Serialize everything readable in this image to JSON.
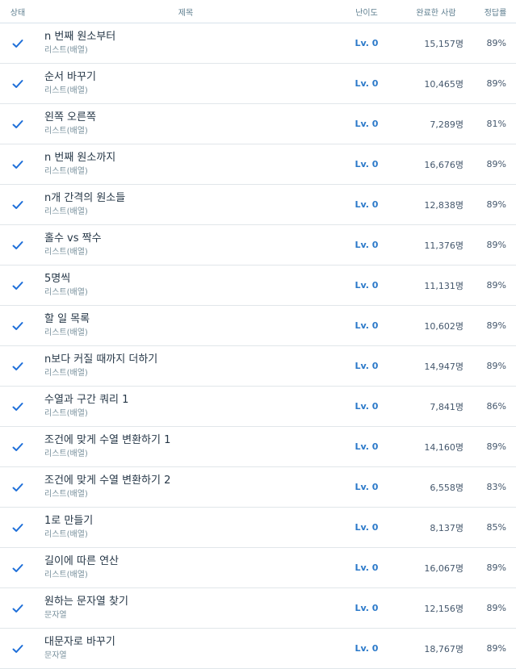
{
  "header": {
    "status": "상태",
    "title": "제목",
    "level": "난이도",
    "completed": "완료한 사람",
    "rate": "정답률"
  },
  "icons": {
    "check": "check-icon",
    "check_color": "#1e6fd9"
  },
  "rows": [
    {
      "title": "n 번째 원소부터",
      "category": "리스트(배열)",
      "level": "Lv. 0",
      "completed": "15,157명",
      "rate": "89%"
    },
    {
      "title": "순서 바꾸기",
      "category": "리스트(배열)",
      "level": "Lv. 0",
      "completed": "10,465명",
      "rate": "89%"
    },
    {
      "title": "왼쪽 오른쪽",
      "category": "리스트(배열)",
      "level": "Lv. 0",
      "completed": "7,289명",
      "rate": "81%"
    },
    {
      "title": "n 번째 원소까지",
      "category": "리스트(배열)",
      "level": "Lv. 0",
      "completed": "16,676명",
      "rate": "89%"
    },
    {
      "title": "n개 간격의 원소들",
      "category": "리스트(배열)",
      "level": "Lv. 0",
      "completed": "12,838명",
      "rate": "89%"
    },
    {
      "title": "홀수 vs 짝수",
      "category": "리스트(배열)",
      "level": "Lv. 0",
      "completed": "11,376명",
      "rate": "89%"
    },
    {
      "title": "5명씩",
      "category": "리스트(배열)",
      "level": "Lv. 0",
      "completed": "11,131명",
      "rate": "89%"
    },
    {
      "title": "할 일 목록",
      "category": "리스트(배열)",
      "level": "Lv. 0",
      "completed": "10,602명",
      "rate": "89%"
    },
    {
      "title": "n보다 커질 때까지 더하기",
      "category": "리스트(배열)",
      "level": "Lv. 0",
      "completed": "14,947명",
      "rate": "89%"
    },
    {
      "title": "수열과 구간 쿼리 1",
      "category": "리스트(배열)",
      "level": "Lv. 0",
      "completed": "7,841명",
      "rate": "86%"
    },
    {
      "title": "조건에 맞게 수열 변환하기 1",
      "category": "리스트(배열)",
      "level": "Lv. 0",
      "completed": "14,160명",
      "rate": "89%"
    },
    {
      "title": "조건에 맞게 수열 변환하기 2",
      "category": "리스트(배열)",
      "level": "Lv. 0",
      "completed": "6,558명",
      "rate": "83%"
    },
    {
      "title": "1로 만들기",
      "category": "리스트(배열)",
      "level": "Lv. 0",
      "completed": "8,137명",
      "rate": "85%"
    },
    {
      "title": "길이에 따른 연산",
      "category": "리스트(배열)",
      "level": "Lv. 0",
      "completed": "16,067명",
      "rate": "89%"
    },
    {
      "title": "원하는 문자열 찾기",
      "category": "문자열",
      "level": "Lv. 0",
      "completed": "12,156명",
      "rate": "89%"
    },
    {
      "title": "대문자로 바꾸기",
      "category": "문자열",
      "level": "Lv. 0",
      "completed": "18,767명",
      "rate": "89%"
    }
  ]
}
